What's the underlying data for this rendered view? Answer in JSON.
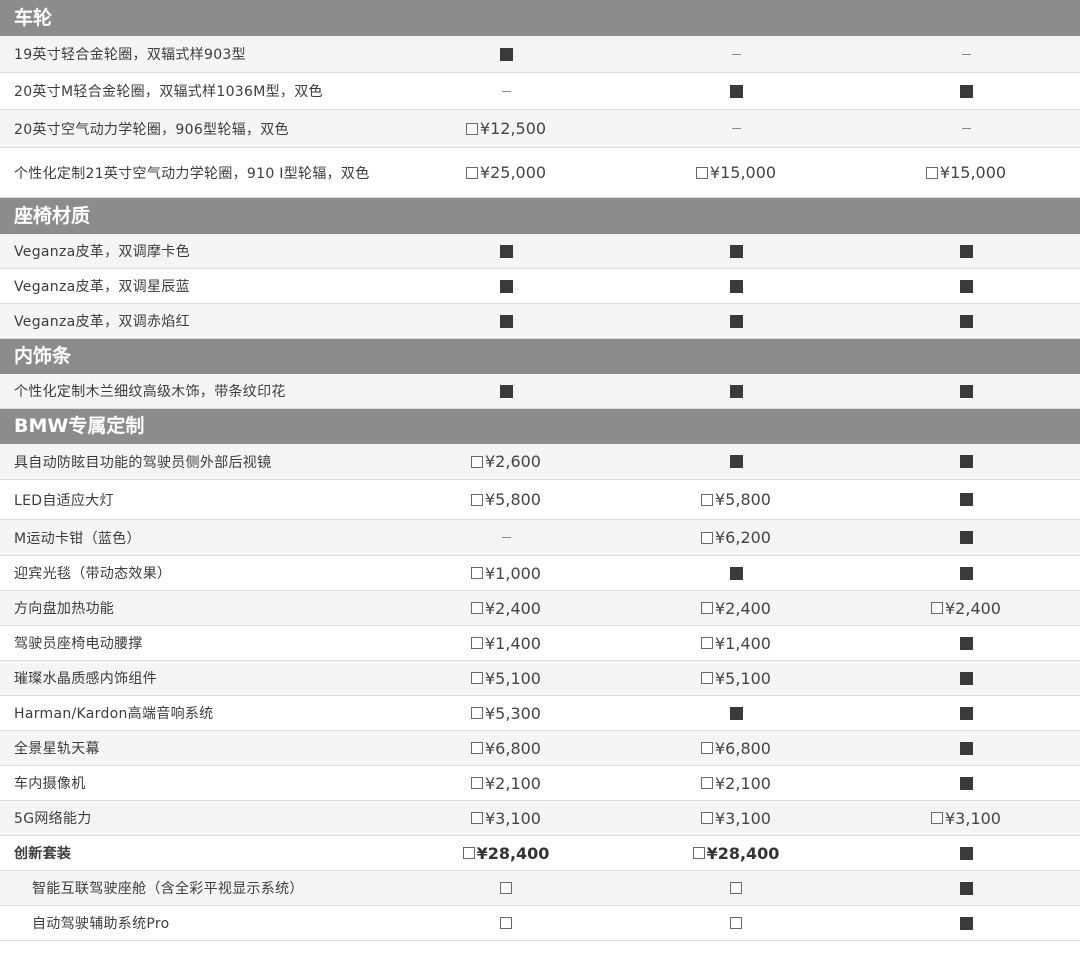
{
  "sections": [
    {
      "title": "车轮",
      "header_height": 36,
      "rows": [
        {
          "label": "19英寸轻合金轮圈，双辐式样903型",
          "h": 37,
          "cells": [
            "std",
            "none",
            "none"
          ]
        },
        {
          "label": "20英寸M轻合金轮圈，双辐式样1036M型，双色",
          "h": 37,
          "cells": [
            "none",
            "std",
            "std"
          ]
        },
        {
          "label": "20英寸空气动力学轮圈，906型轮辐，双色",
          "h": 38,
          "cells": [
            "¥12,500",
            "none",
            "none"
          ]
        },
        {
          "label": "个性化定制21英寸空气动力学轮圈，910 I型轮辐，双色",
          "h": 50,
          "cells": [
            "¥25,000",
            "¥15,000",
            "¥15,000"
          ]
        }
      ]
    },
    {
      "title": "座椅材质",
      "header_height": 36,
      "rows": [
        {
          "label": "Veganza皮革，双调摩卡色",
          "h": 35,
          "cells": [
            "std",
            "std",
            "std"
          ]
        },
        {
          "label": "Veganza皮革，双调星辰蓝",
          "h": 35,
          "cells": [
            "std",
            "std",
            "std"
          ]
        },
        {
          "label": "Veganza皮革，双调赤焰红",
          "h": 35,
          "cells": [
            "std",
            "std",
            "std"
          ]
        }
      ]
    },
    {
      "title": "内饰条",
      "header_height": 35,
      "rows": [
        {
          "label": "个性化定制木兰细纹高级木饰，带条纹印花",
          "h": 35,
          "cells": [
            "std",
            "std",
            "std"
          ]
        }
      ]
    },
    {
      "title": "BMW专属定制",
      "header_height": 35,
      "rows": [
        {
          "label": "具自动防眩目功能的驾驶员侧外部后视镜",
          "h": 36,
          "cells": [
            "¥2,600",
            "std",
            "std"
          ]
        },
        {
          "label": "LED自适应大灯",
          "h": 40,
          "cells": [
            "¥5,800",
            "¥5,800",
            "std"
          ]
        },
        {
          "label": "M运动卡钳（蓝色）",
          "h": 36,
          "cells": [
            "none",
            "¥6,200",
            "std"
          ]
        },
        {
          "label": "迎宾光毯（带动态效果）",
          "h": 35,
          "cells": [
            "¥1,000",
            "std",
            "std"
          ]
        },
        {
          "label": "方向盘加热功能",
          "h": 35,
          "cells": [
            "¥2,400",
            "¥2,400",
            "¥2,400"
          ]
        },
        {
          "label": "驾驶员座椅电动腰撑",
          "h": 35,
          "cells": [
            "¥1,400",
            "¥1,400",
            "std"
          ]
        },
        {
          "label": "璀璨水晶质感内饰组件",
          "h": 35,
          "cells": [
            "¥5,100",
            "¥5,100",
            "std"
          ]
        },
        {
          "label": "Harman/Kardon高端音响系统",
          "h": 35,
          "cells": [
            "¥5,300",
            "std",
            "std"
          ]
        },
        {
          "label": "全景星轨天幕",
          "h": 35,
          "cells": [
            "¥6,800",
            "¥6,800",
            "std"
          ]
        },
        {
          "label": "车内摄像机",
          "h": 35,
          "cells": [
            "¥2,100",
            "¥2,100",
            "std"
          ]
        },
        {
          "label": "5G网络能力",
          "h": 35,
          "cells": [
            "¥3,100",
            "¥3,100",
            "¥3,100"
          ]
        },
        {
          "label": "创新套装",
          "h": 35,
          "bold": true,
          "cells": [
            "¥28,400",
            "¥28,400",
            "std"
          ]
        },
        {
          "label": "智能互联驾驶座舱（含全彩平视显示系统）",
          "h": 35,
          "sub": true,
          "cells": [
            "box",
            "box",
            "std"
          ]
        },
        {
          "label": "自动驾驶辅助系统Pro",
          "h": 35,
          "sub": true,
          "cells": [
            "box",
            "box",
            "std"
          ]
        }
      ]
    }
  ]
}
